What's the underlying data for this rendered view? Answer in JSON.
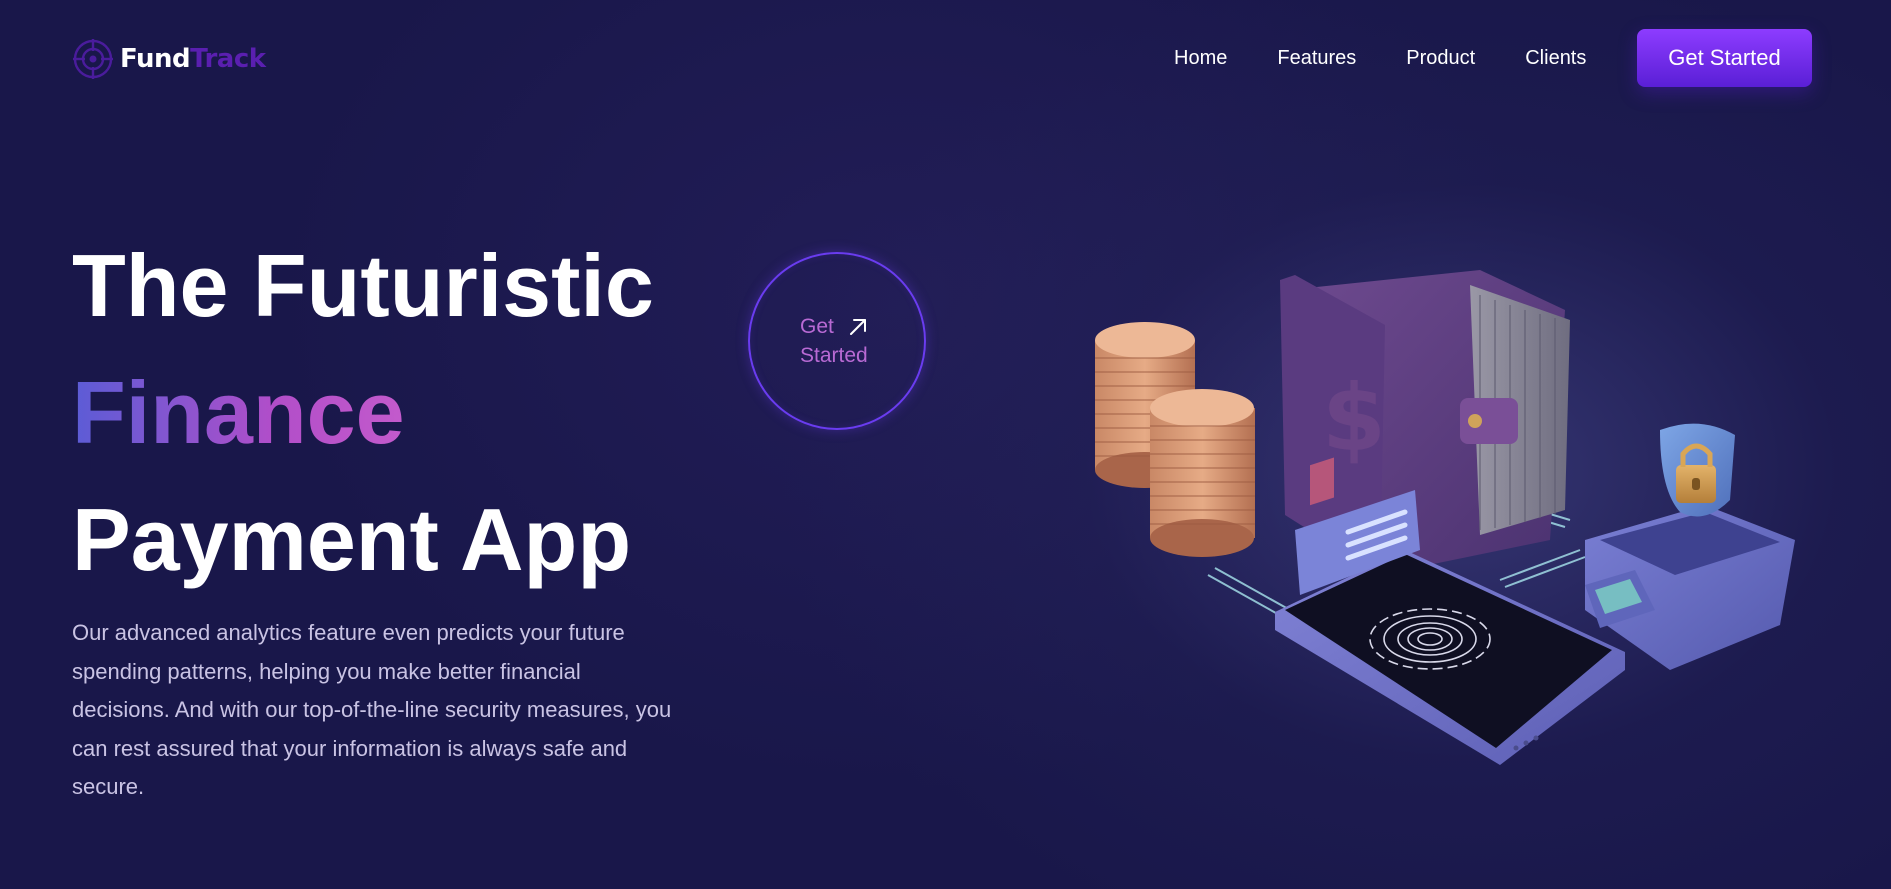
{
  "brand": {
    "name_part1": "Fund",
    "name_part2": "Track",
    "icon": "target-icon"
  },
  "nav": {
    "links": [
      "Home",
      "Features",
      "Product",
      "Clients"
    ],
    "cta_label": "Get Started"
  },
  "hero": {
    "title_line1": "The Futuristic",
    "title_line2": "Finance",
    "title_line3": "Payment App",
    "description": "Our advanced analytics feature even predicts your future spending patterns, helping you make better financial decisions. And with our top-of-the-line security measures, you can rest assured that your information is always safe and secure.",
    "circle_cta_label": "Get Started",
    "illustration_icon": "finance-illustration"
  },
  "colors": {
    "background": "#19174a",
    "accent": "#7b2ff7",
    "brand_track": "#5a1fb0",
    "gradient_start": "#5b5cd6",
    "gradient_mid": "#c55ccc"
  }
}
